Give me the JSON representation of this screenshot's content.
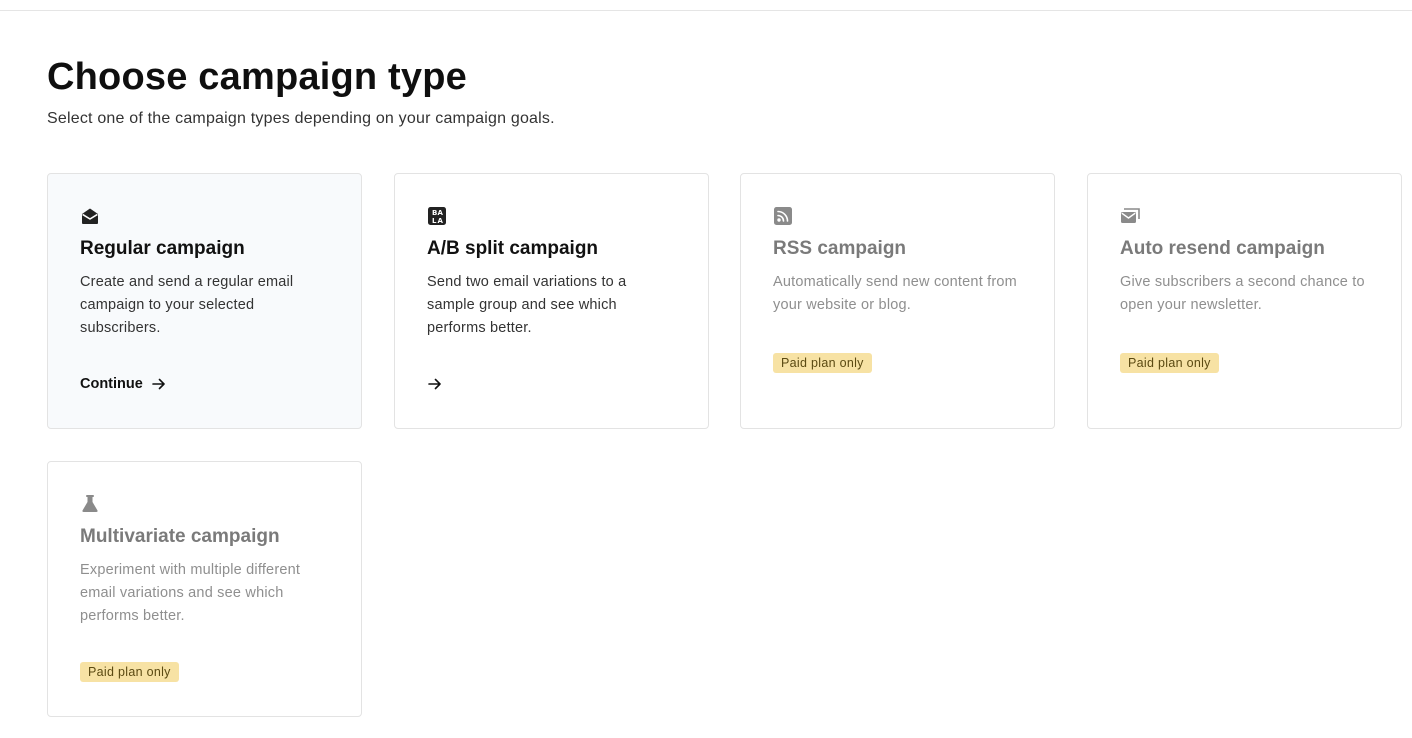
{
  "page": {
    "title": "Choose campaign type",
    "subtitle": "Select one of the campaign types depending on your campaign goals."
  },
  "cards": [
    {
      "title": "Regular campaign",
      "description": "Create and send a regular email campaign to your selected subscribers.",
      "action_label": "Continue",
      "icon": "open-envelope-icon"
    },
    {
      "title": "A/B split campaign",
      "description": "Send two email variations to a sample group and see which performs better.",
      "action_label": "",
      "icon": "ab-split-icon"
    },
    {
      "title": "RSS campaign",
      "description": "Automatically send new content from your website or blog.",
      "badge": "Paid plan only",
      "icon": "rss-icon"
    },
    {
      "title": "Auto resend campaign",
      "description": "Give subscribers a second chance to open your newsletter.",
      "badge": "Paid plan only",
      "icon": "stacked-envelopes-icon"
    },
    {
      "title": "Multivariate campaign",
      "description": "Experiment with multiple different email variations and see which performs better.",
      "badge": "Paid plan only",
      "icon": "flask-icon"
    }
  ],
  "colors": {
    "badge_bg": "#f7e2a4",
    "badge_text": "#5b4a12",
    "selected_card_bg": "#f8fafc",
    "disabled_text": "#8f8f8f"
  }
}
